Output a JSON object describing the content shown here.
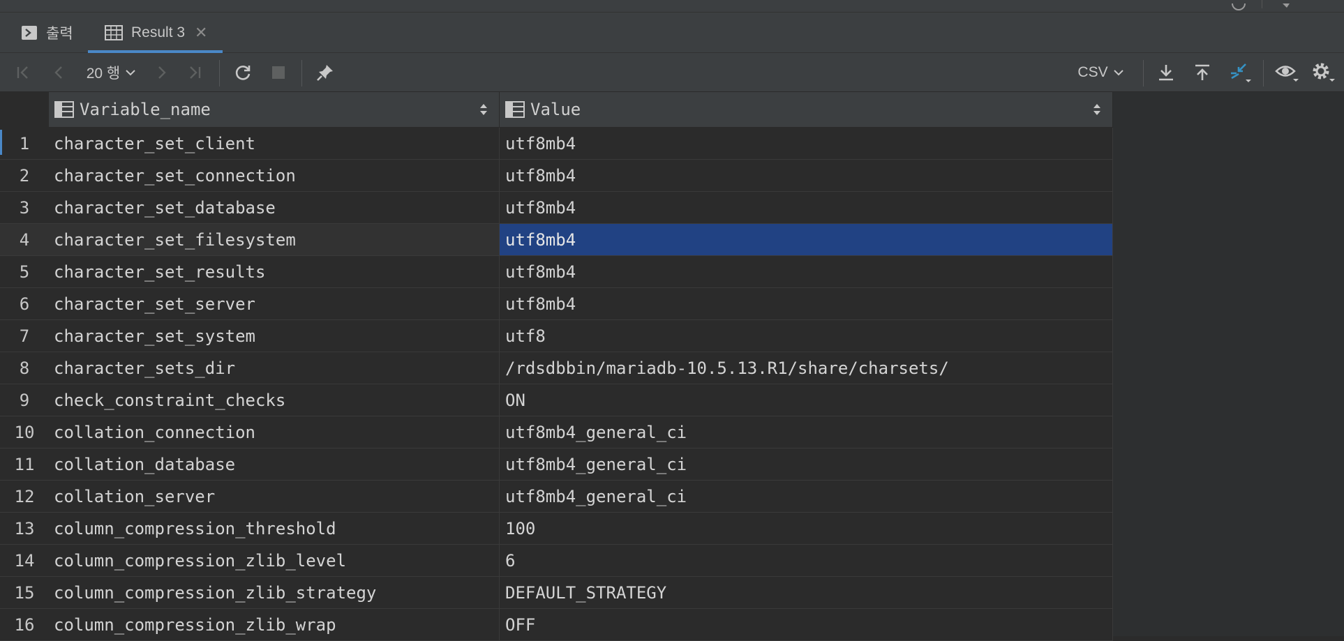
{
  "tabs": [
    {
      "label": "출력",
      "icon": "console-icon",
      "active": false
    },
    {
      "label": "Result 3",
      "icon": "table-icon",
      "active": true
    }
  ],
  "toolbar": {
    "rows_label": "20 행",
    "export_format": "CSV"
  },
  "columns": [
    "Variable_name",
    "Value"
  ],
  "selected_row": 4,
  "rows": [
    {
      "n": "1",
      "name": "character_set_client",
      "value": "utf8mb4"
    },
    {
      "n": "2",
      "name": "character_set_connection",
      "value": "utf8mb4"
    },
    {
      "n": "3",
      "name": "character_set_database",
      "value": "utf8mb4"
    },
    {
      "n": "4",
      "name": "character_set_filesystem",
      "value": "utf8mb4"
    },
    {
      "n": "5",
      "name": "character_set_results",
      "value": "utf8mb4"
    },
    {
      "n": "6",
      "name": "character_set_server",
      "value": "utf8mb4"
    },
    {
      "n": "7",
      "name": "character_set_system",
      "value": "utf8"
    },
    {
      "n": "8",
      "name": "character_sets_dir",
      "value": "/rdsdbbin/mariadb-10.5.13.R1/share/charsets/"
    },
    {
      "n": "9",
      "name": "check_constraint_checks",
      "value": "ON"
    },
    {
      "n": "10",
      "name": "collation_connection",
      "value": "utf8mb4_general_ci"
    },
    {
      "n": "11",
      "name": "collation_database",
      "value": "utf8mb4_general_ci"
    },
    {
      "n": "12",
      "name": "collation_server",
      "value": "utf8mb4_general_ci"
    },
    {
      "n": "13",
      "name": "column_compression_threshold",
      "value": "100"
    },
    {
      "n": "14",
      "name": "column_compression_zlib_level",
      "value": "6"
    },
    {
      "n": "15",
      "name": "column_compression_zlib_strategy",
      "value": "DEFAULT_STRATEGY"
    },
    {
      "n": "16",
      "name": "column_compression_zlib_wrap",
      "value": "OFF"
    }
  ],
  "colors": {
    "selection": "#214283",
    "accent": "#4a88c7",
    "panel": "#3c3f41",
    "grid_bg": "#2b2b2b"
  }
}
